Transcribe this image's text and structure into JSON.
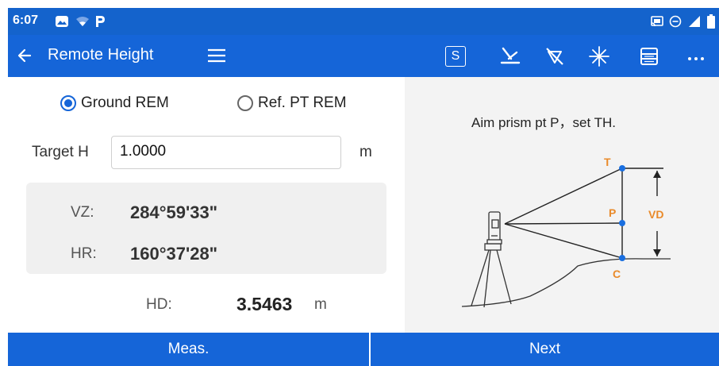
{
  "status_bar": {
    "time": "6:07",
    "left_icons": [
      "image-app-icon",
      "wifi-icon",
      "p-app-icon"
    ],
    "right_icons": [
      "cast-icon",
      "do-not-disturb-icon",
      "signal-icon",
      "battery-icon"
    ]
  },
  "app_bar": {
    "title": "Remote Height",
    "action_s_label": "S",
    "icons": [
      "back-arrow-icon",
      "hamburger-menu-icon",
      "s-icon",
      "laser-plummet-icon",
      "no-prism-icon",
      "star-icon",
      "list-icon",
      "more-icon"
    ]
  },
  "mode": {
    "options": [
      "Ground REM",
      "Ref. PT REM"
    ],
    "selected": "Ground REM"
  },
  "target": {
    "label": "Target H",
    "value": "1.0000",
    "unit": "m"
  },
  "angles": {
    "vz_label": "VZ:",
    "vz_value": "284°59'33\"",
    "hr_label": "HR:",
    "hr_value": "160°37'28\""
  },
  "hd": {
    "label": "HD:",
    "value": "3.5463",
    "unit": "m"
  },
  "diagram": {
    "instruction": "Aim prism pt P，set TH.",
    "label_t": "T",
    "label_p": "P",
    "label_c": "C",
    "label_vd": "VD",
    "label_color": "#e98a2a",
    "point_color": "#1a6fe0"
  },
  "buttons": {
    "meas": "Meas.",
    "next": "Next"
  },
  "colors": {
    "primary": "#1565d8",
    "status_bar": "#1463cc",
    "panel_bg": "#f3f3f3",
    "box_bg": "#f0f0f0"
  }
}
